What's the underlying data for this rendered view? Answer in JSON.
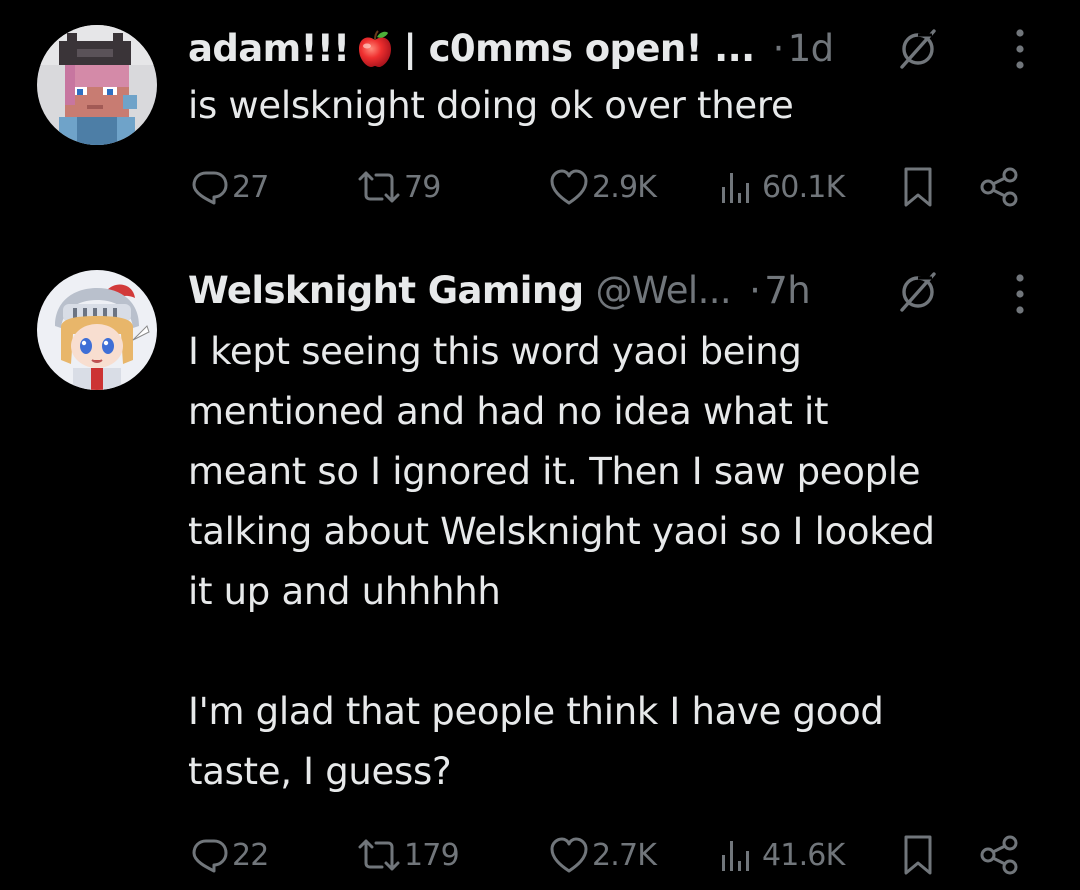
{
  "tweets": [
    {
      "display_name": "adam!!!",
      "name_suffix": "| c0mms open! ...",
      "handle": "",
      "separator": "·",
      "time": "1d",
      "text": "is welsknight doing ok over there",
      "replies": "27",
      "retweets": "79",
      "likes": "2.9K",
      "views": "60.1K"
    },
    {
      "display_name": "Welsknight Gaming",
      "name_suffix": "",
      "handle": "@Wel...",
      "separator": "·",
      "time": "7h",
      "text": "I kept seeing this word yaoi being\nmentioned and had no idea what it\nmeant so I ignored it. Then I saw people\ntalking about Welsknight yaoi so I looked\nit up and uhhhhh\n\nI'm glad that people think I have good\ntaste, I guess?",
      "replies": "22",
      "retweets": "179",
      "likes": "2.7K",
      "views": "41.6K"
    }
  ],
  "icons": {
    "reply": "reply-icon",
    "retweet": "retweet-icon",
    "like": "heart-icon",
    "views": "views-icon",
    "bookmark": "bookmark-icon",
    "share": "share-icon",
    "grok": "grok-icon",
    "more": "more-options-icon",
    "apple": "apple-emoji-icon"
  },
  "colors": {
    "background": "#000000",
    "text_primary": "#e7e9ea",
    "text_secondary": "#71767b"
  }
}
